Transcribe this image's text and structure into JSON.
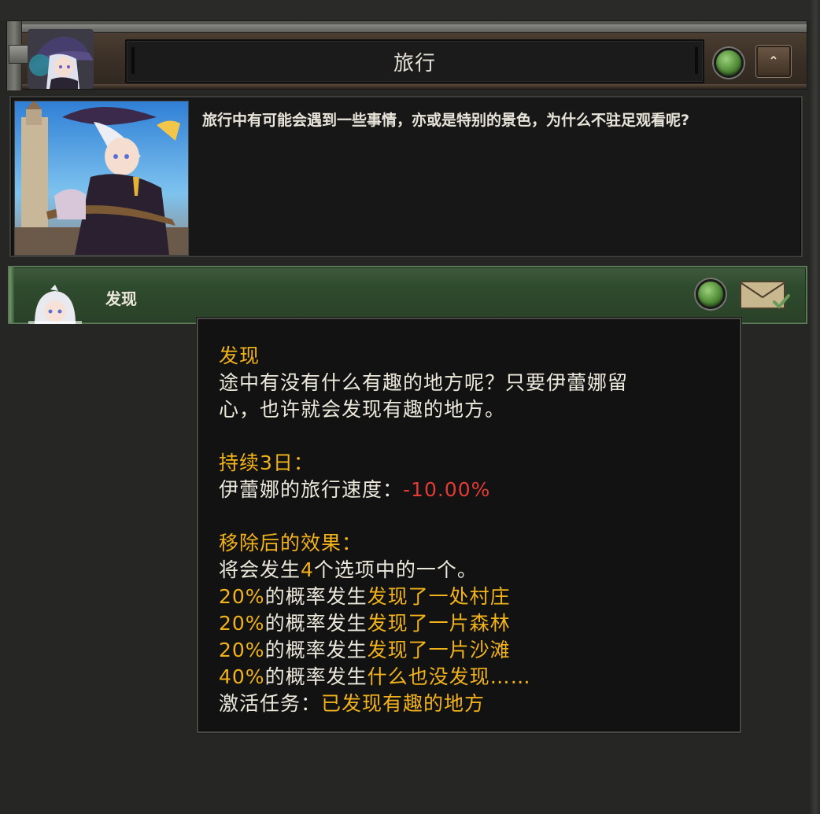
{
  "header": {
    "title": "旅行"
  },
  "description": {
    "text": "旅行中有可能会遇到一些事情，亦或是特别的景色，为什么不驻足观看呢?"
  },
  "modifier": {
    "label": "发现"
  },
  "tooltip": {
    "title": "发现",
    "desc_line1": "途中有没有什么有趣的地方呢？只要伊蕾娜留",
    "desc_line2": "心，也许就会发现有趣的地方。",
    "duration_label": "持续3日：",
    "effect_name": "伊蕾娜的旅行速度：",
    "effect_value": "-10.00%",
    "after_label": "移除后的效果：",
    "will_happen_pre": "将会发生",
    "will_happen_num": "4",
    "will_happen_post": "个选项中的一个。",
    "outcomes": [
      {
        "percent": "20%",
        "mid": "的概率发生",
        "event": "发现了一处村庄"
      },
      {
        "percent": "20%",
        "mid": "的概率发生",
        "event": "发现了一片森林"
      },
      {
        "percent": "20%",
        "mid": "的概率发生",
        "event": "发现了一片沙滩"
      },
      {
        "percent": "40%",
        "mid": "的概率发生",
        "event": "什么也没发现……"
      }
    ],
    "activate_label": "激活任务：",
    "activate_value": "已发现有趣的地方"
  },
  "colors": {
    "gold": "#f2b31a",
    "negative": "#e23a35",
    "text": "#ece8dc",
    "modifier_green": "#2f4b2e"
  }
}
